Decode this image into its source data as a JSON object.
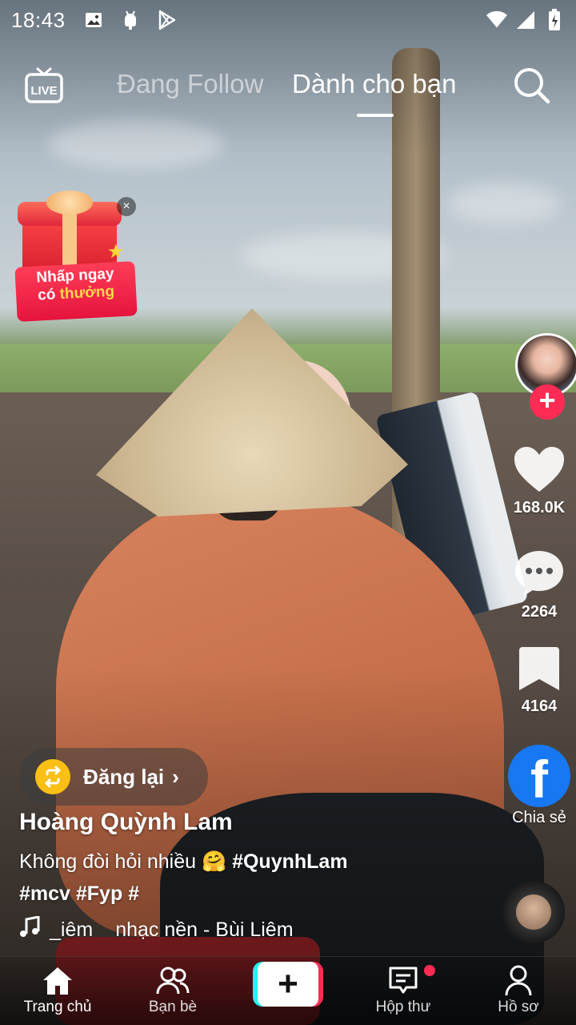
{
  "status_bar": {
    "time": "18:43",
    "left_icons": [
      "image-icon",
      "android-icon",
      "play-store-icon"
    ],
    "right_icons": [
      "wifi-icon",
      "signal-icon",
      "battery-icon"
    ]
  },
  "top_nav": {
    "live_label": "LIVE",
    "tab_following": "Đang Follow",
    "tab_for_you": "Dành cho bạn",
    "active_tab": "Dành cho bạn"
  },
  "reward_widget": {
    "line1": "Nhấp ngay",
    "line2_prefix": "có",
    "line2_highlight": "thưởng"
  },
  "rail": {
    "likes": "168.0K",
    "comments": "2264",
    "saves": "4164",
    "share_label": "Chia sẻ"
  },
  "repost": {
    "label": "Đăng lại"
  },
  "video": {
    "author": "Hoàng Quỳnh Lam",
    "caption_text": "Không đòi hỏi nhiều",
    "caption_emoji": "🤗",
    "caption_tag": "#QuynhLam",
    "caption_line2": "#mcv #Fyp #",
    "sound_part1": "_iêm",
    "sound_part2": "nhạc nền - Bùi Liêm"
  },
  "bottom_nav": {
    "home": "Trang chủ",
    "friends": "Bạn bè",
    "inbox": "Hộp thư",
    "profile": "Hồ sơ"
  },
  "colors": {
    "accent_red": "#fe2c55",
    "accent_cyan": "#25f4ee",
    "facebook_blue": "#1877f2",
    "repost_yellow": "#fbbf15"
  }
}
